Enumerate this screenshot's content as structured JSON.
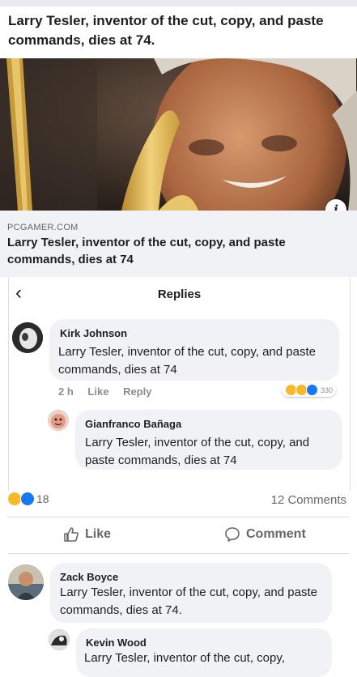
{
  "post": {
    "text": "Larry Tesler, inventor of the cut, copy, and paste commands, dies at 74.",
    "link_domain": "PCGAMER.COM",
    "link_title": "Larry Tesler, inventor of the cut, copy, and paste commands, dies at 74"
  },
  "replies_panel": {
    "title": "Replies",
    "comments": [
      {
        "name": "Kirk Johnson",
        "text": "Larry Tesler, inventor of the cut, copy, and paste commands, dies at 74",
        "time": "2 h",
        "like_label": "Like",
        "reply_label": "Reply",
        "reaction_count": "330"
      },
      {
        "name": "Gianfranco Bañaga",
        "text": "Larry Tesler, inventor of the cut, copy, and paste commands, dies at 74"
      }
    ]
  },
  "post_stats": {
    "reaction_count": "18",
    "comments_label": "12 Comments"
  },
  "actions": {
    "like_label": "Like",
    "comment_label": "Comment"
  },
  "comments": [
    {
      "name": "Zack Boyce",
      "text": "Larry Tesler, inventor of the cut, copy, and paste commands, dies at 74."
    },
    {
      "name": "Kevin Wood",
      "text": "Larry Tesler, inventor of the cut, copy,"
    }
  ],
  "colors": {
    "like_blue": "#1877f2",
    "haha_yellow": "#f7b928",
    "bubble_grey": "#f0f2f5",
    "meta_grey": "#8a8d91"
  }
}
